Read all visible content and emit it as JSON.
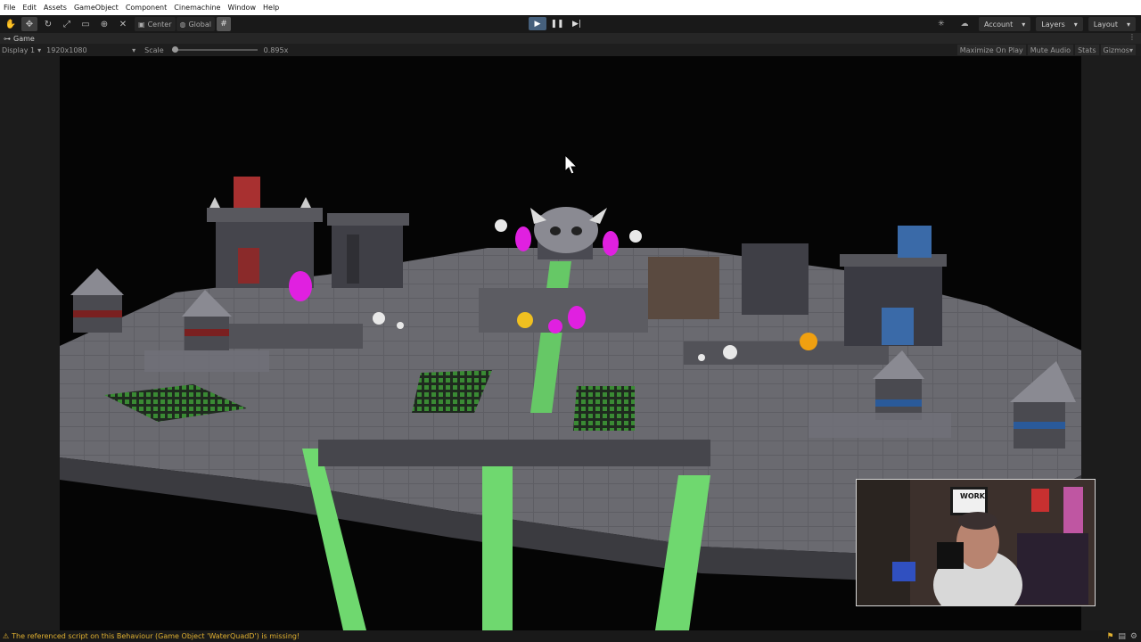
{
  "menu": [
    "File",
    "Edit",
    "Assets",
    "GameObject",
    "Component",
    "Cinemachine",
    "Window",
    "Help"
  ],
  "toolbar": {
    "pivot_label": "Center",
    "space_label": "Global",
    "account_label": "Account",
    "layers_label": "Layers",
    "layout_label": "Layout"
  },
  "tab": {
    "title": "Game"
  },
  "gamebar": {
    "display_label": "Display 1",
    "resolution_label": "1920x1080",
    "scale_label": "Scale",
    "scale_value": "0.895x",
    "maximize_label": "Maximize On Play",
    "mute_label": "Mute Audio",
    "stats_label": "Stats",
    "gizmos_label": "Gizmos"
  },
  "webcam": {
    "poster_text": "WORK"
  },
  "status": {
    "message": "The referenced script on this Behaviour (Game Object 'WaterQuadD') is missing!"
  },
  "colors": {
    "play_active": "#46607c",
    "warning": "#e0b030",
    "slime": "#6fd86f",
    "magic_fire": "#e020e0",
    "fire": "#f0c020"
  }
}
